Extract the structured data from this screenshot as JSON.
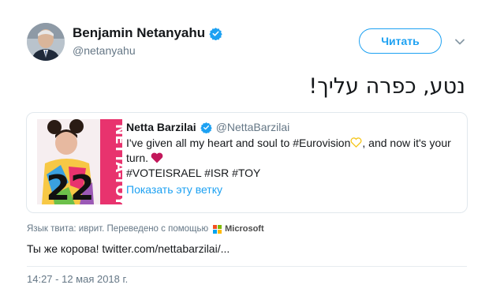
{
  "author": {
    "name": "Benjamin Netanyahu",
    "handle": "@netanyahu"
  },
  "follow_button": "Читать",
  "tweet_text": "נטע, כפרה עליך!",
  "quote": {
    "name": "Netta Barzilai",
    "handle": "@NettaBarzilai",
    "text_part1": "I've given all my heart and soul to #Eurovision",
    "text_part2": ", and now it's your turn.",
    "hashtags": "#VOTEISRAEL #ISR #TOY",
    "show_thread": "Показать эту ветку",
    "image": {
      "number": "22",
      "title": "NETTA-TOY"
    }
  },
  "translation": {
    "label": "Язык твита: иврит. Переведено с помощью",
    "provider": "Microsoft",
    "translated_text": "Ты же корова! twitter.com/nettabarzilai/..."
  },
  "timestamp": "14:27 - 12 мая 2018 г.",
  "colors": {
    "accent": "#1da1f2",
    "secondary_text": "#657786",
    "heart_red": "#c2185b",
    "heart_yellow": "#f5c518"
  }
}
